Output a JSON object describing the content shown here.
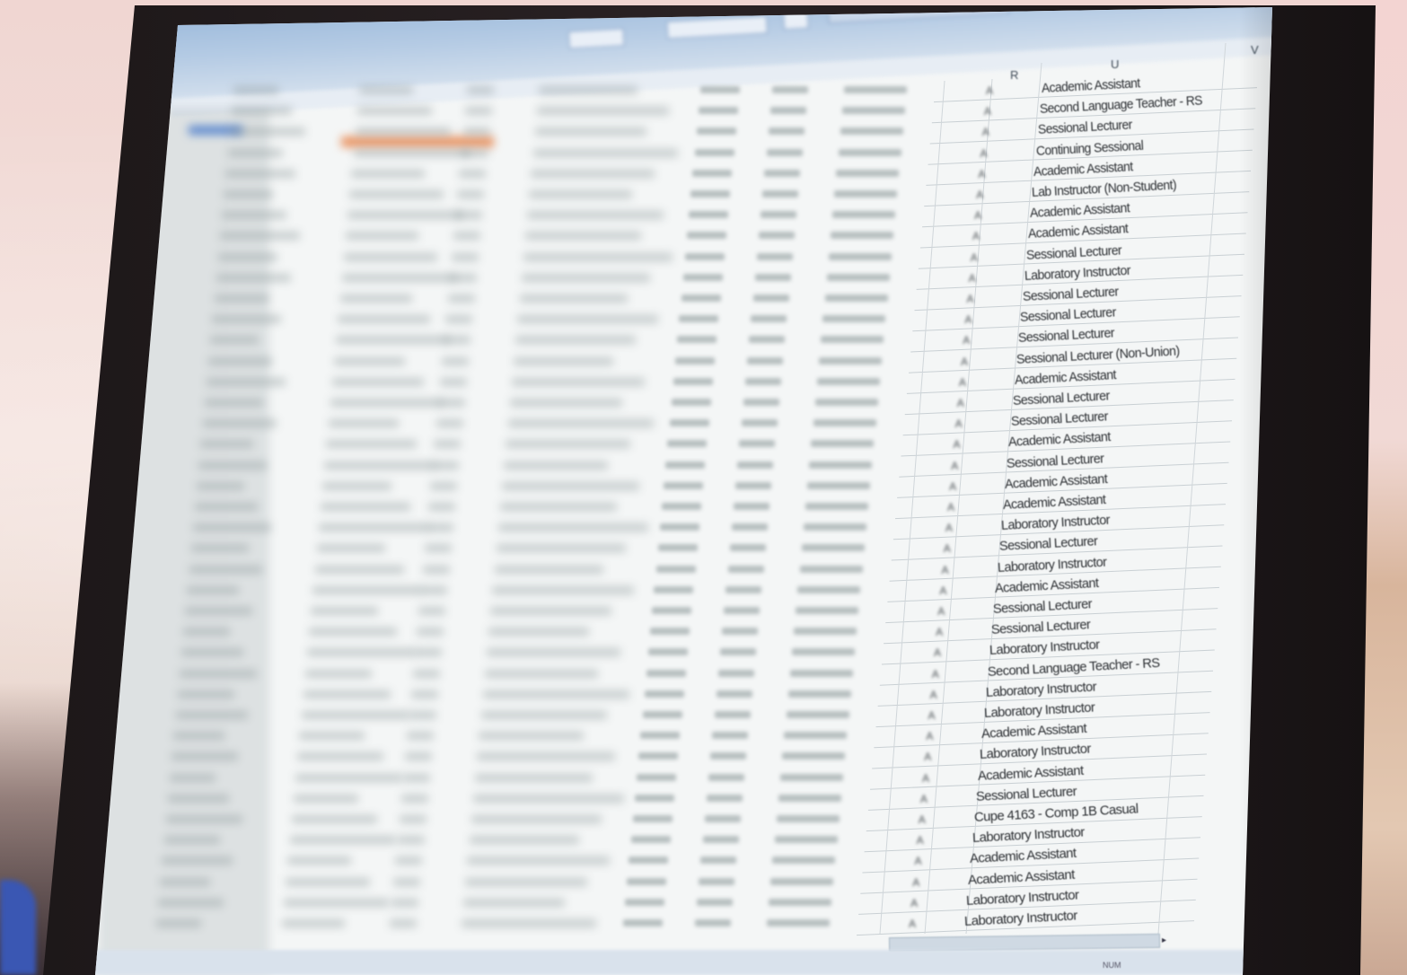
{
  "scene": {
    "description_colors": {
      "wall": "#f0d6d2",
      "bezel": "#1c1718",
      "screen": "#f4f6f6",
      "ribbon": "#93b4d8",
      "text": "#2c2f33"
    }
  },
  "spreadsheet": {
    "column_letters": {
      "r": "R",
      "u": "U",
      "v": "V"
    },
    "job_titles": [
      "Academic Assistant",
      "Second Language Teacher - RS",
      "Sessional Lecturer",
      "Continuing Sessional",
      "Academic Assistant",
      "Lab Instructor (Non-Student)",
      "Academic Assistant",
      "Academic Assistant",
      "Sessional Lecturer",
      "Laboratory Instructor",
      "Sessional Lecturer",
      "Sessional Lecturer",
      "Sessional Lecturer",
      "Sessional Lecturer (Non-Union)",
      "Academic Assistant",
      "Sessional Lecturer",
      "Sessional Lecturer",
      "Academic Assistant",
      "Sessional Lecturer",
      "Academic Assistant",
      "Academic Assistant",
      "Laboratory Instructor",
      "Sessional Lecturer",
      "Laboratory Instructor",
      "Academic Assistant",
      "Sessional Lecturer",
      "Sessional Lecturer",
      "Laboratory Instructor",
      "Second Language Teacher - RS",
      "Laboratory Instructor",
      "Laboratory Instructor",
      "Academic Assistant",
      "Laboratory Instructor",
      "Academic Assistant",
      "Sessional Lecturer",
      "Cupe 4163 - Comp 1B Casual",
      "Laboratory Instructor",
      "Academic Assistant",
      "Academic Assistant",
      "Laboratory Instructor",
      "Laboratory Instructor"
    ],
    "status_letter": "A",
    "status_bar_text": "NUM"
  }
}
